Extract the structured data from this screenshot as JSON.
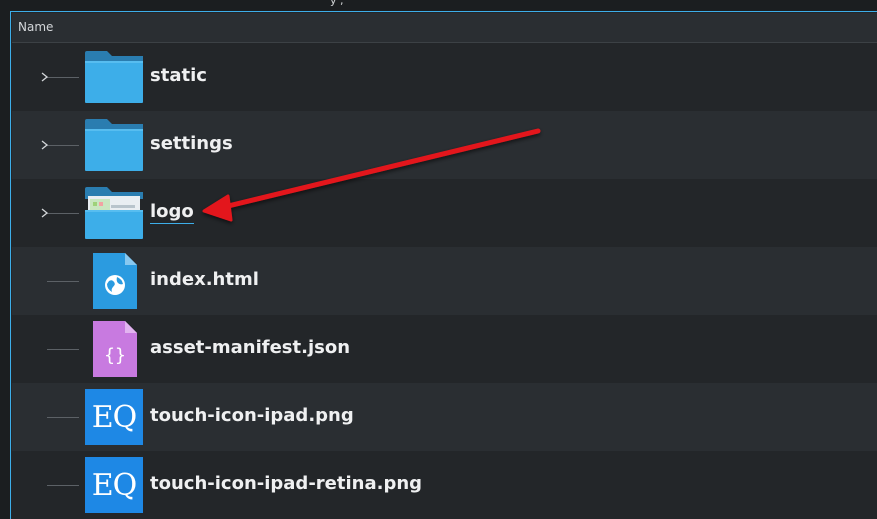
{
  "header": {
    "name_column": "Name"
  },
  "window_title_fragment": "y ,",
  "files": [
    {
      "name": "static",
      "type": "folder",
      "expandable": true,
      "icon": "folder-icon"
    },
    {
      "name": "settings",
      "type": "folder",
      "expandable": true,
      "icon": "folder-icon"
    },
    {
      "name": "logo",
      "type": "folder",
      "expandable": true,
      "icon": "folder-image-preview-icon",
      "renaming": true
    },
    {
      "name": "index.html",
      "type": "file",
      "expandable": false,
      "icon": "html-file-icon"
    },
    {
      "name": "asset-manifest.json",
      "type": "file",
      "expandable": false,
      "icon": "json-file-icon"
    },
    {
      "name": "touch-icon-ipad.png",
      "type": "file",
      "expandable": false,
      "icon": "eq-image-icon",
      "badge": "EQ"
    },
    {
      "name": "touch-icon-ipad-retina.png",
      "type": "file",
      "expandable": false,
      "icon": "eq-image-icon",
      "badge": "EQ"
    }
  ],
  "colors": {
    "accent": "#3daee9",
    "folder": "#3daee9",
    "annotation_arrow": "#e3191c",
    "json_icon": "#c87ae0",
    "eq_badge": "#1e88e5"
  }
}
